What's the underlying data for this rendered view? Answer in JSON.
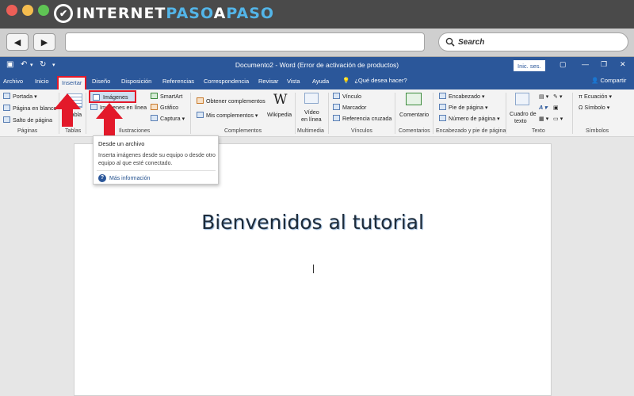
{
  "colors": {
    "word_blue": "#2b579a",
    "highlight_red": "#e3192a",
    "arrow_red": "#e3192a",
    "logo_blue": "#53b5e8"
  },
  "site_logo": {
    "part1": "INTERNET",
    "part2": "PASO",
    "part3": "A",
    "part4": "PASO"
  },
  "browser": {
    "back_icon": "triangle-left",
    "forward_icon": "triangle-right",
    "search_placeholder": "Search"
  },
  "word": {
    "title": "Documento2 - Word (Error de activación de productos)",
    "signin_label": "Inic. ses.",
    "tabs": [
      "Archivo",
      "Inicio",
      "Insertar",
      "Diseño",
      "Disposición",
      "Referencias",
      "Correspondencia",
      "Revisar",
      "Vista",
      "Ayuda"
    ],
    "tell_me": "¿Qué desea hacer?",
    "share": "Compartir",
    "ribbon": {
      "paginas": {
        "items": [
          "Portada",
          "Página en blanco",
          "Salto de página"
        ],
        "group": "Páginas"
      },
      "tablas": {
        "item": "Tabla",
        "group": "Tablas"
      },
      "ilustraciones": {
        "items": [
          "Imágenes",
          "Imágenes en línea",
          "SmartArt",
          "Gráfico",
          "Captura"
        ],
        "group": "Ilustraciones"
      },
      "complementos": {
        "items": [
          "Obtener complementos",
          "Mis complementos",
          "Wikipedia"
        ],
        "group": "Complementos"
      },
      "multimedia": {
        "line1": "Vídeo",
        "line2": "en línea",
        "group": "Multimedia"
      },
      "vinculos": {
        "items": [
          "Vínculo",
          "Marcador",
          "Referencia cruzada"
        ],
        "group": "Vínculos"
      },
      "comentarios": {
        "item": "Comentario",
        "group": "Comentarios"
      },
      "encabezado": {
        "items": [
          "Encabezado",
          "Pie de página",
          "Número de página"
        ],
        "group": "Encabezado y pie de página"
      },
      "texto": {
        "line1": "Cuadro de",
        "line2": "texto",
        "group": "Texto"
      },
      "simbolos": {
        "items": [
          "Ecuación",
          "Símbolo"
        ],
        "group": "Símbolos"
      }
    },
    "tooltip": {
      "title": "Desde un archivo",
      "description": "Inserta imágenes desde su equipo o desde otro equipo al que esté conectado.",
      "more": "Más información"
    },
    "document": {
      "heading": "Bienvenidos al tutorial"
    }
  }
}
